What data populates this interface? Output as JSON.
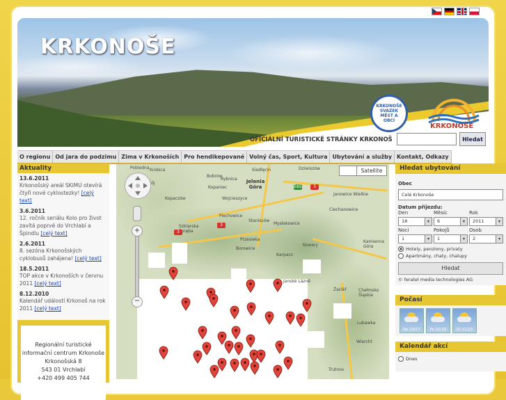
{
  "header": {
    "brand_title": "KRKONOŠE",
    "subtitle": "OFICIÁLNÍ TURISTICKÉ STRÁNKY KRKONOŠ",
    "search_button": "Hledat",
    "logo_text": "KRKONOŠE",
    "seal_text": "KRKONOŠE SVAZEK MĚST A OBCÍ",
    "flags": [
      "cz",
      "de",
      "gb",
      "pl"
    ]
  },
  "nav": {
    "items": [
      "O regionu",
      "Od jara do podzimu",
      "Zima v Krkonoších",
      "Pro hendikepované",
      "Volný čas, Sport, Kultura",
      "Ubytování a služby",
      "Kontakt, Odkazy"
    ]
  },
  "news": {
    "title": "Aktuality",
    "more_label": "[celý text]",
    "items": [
      {
        "date": "13.6.2011",
        "text": "Krkonošský areál SKiMU otevírá čtyři nové cyklostezky!"
      },
      {
        "date": "3.6.2011",
        "text": "12. ročník seriálu Kolo pro život zavítá poprvé do Vrchlabí a Špindlu"
      },
      {
        "date": "2.6.2011",
        "text": "8. sezóna Krkonošských cyklobusů zahájena!"
      },
      {
        "date": "18.5.2011",
        "text": "TOP akce v Krkonoších v červnu 2011"
      },
      {
        "date": "8.12.2010",
        "text": "Kalendář událostí Krkonoš na rok 2011"
      }
    ]
  },
  "info_center": {
    "line1": "Regionální turistické",
    "line2": "informační centrum Krkonoše",
    "line3": "Krkonošská 8",
    "line4": "543 01 Vrchlabí",
    "line5": "+420 499 405 744"
  },
  "map": {
    "type_button": "Satellite",
    "places": [
      "Pobiedna",
      "Krobica",
      "Zdrój",
      "Siedlęcin",
      "Jelenia Góra",
      "Dziwiszów",
      "Bobrów",
      "Rybnica",
      "Kopaniec",
      "Wojcieszyce",
      "Janowice Wielkie",
      "Kopaczów",
      "Piechowice",
      "Szklarska Poręba",
      "Staniszów",
      "Mysłakowice",
      "Ciechanowice",
      "Przesieka",
      "Borowice",
      "Kowary",
      "Karpacz",
      "Kamienna Góra",
      "Chełmsko Śląskie",
      "Lubawka",
      "Janské Lázně",
      "Žacléř",
      "Trutnov",
      "Wiercht"
    ]
  },
  "accommodation": {
    "title": "Hledat ubytování",
    "obec_label": "Obec",
    "obec_value": "Celé Krkonoše",
    "date_label": "Datum příjezdu:",
    "col_den": "Den",
    "col_mesic": "Měsíc",
    "col_rok": "Rok",
    "den_value": "18",
    "mesic_value": "6",
    "rok_value": "2011",
    "col_noci": "Noci",
    "col_pokoji": "Pokojů",
    "col_osob": "Osob",
    "noci_value": "1",
    "pokoji_value": "1",
    "osob_value": "2",
    "radio1": "Hotely, penziony, privaty",
    "radio2": "Apartmány, chaty, chalupy",
    "search_button": "Hledat",
    "copyright": "© feratel media technologies AG"
  },
  "weather": {
    "title": "Počasí",
    "days": [
      "Ne 10/17",
      "Po 10/19",
      "Út 11/25"
    ]
  },
  "calendar": {
    "title": "Kalendář akcí",
    "first_item": "Dnes"
  },
  "colors": {
    "accent": "#e7c634",
    "link": "#1a44b0",
    "pin": "#e0443a"
  }
}
